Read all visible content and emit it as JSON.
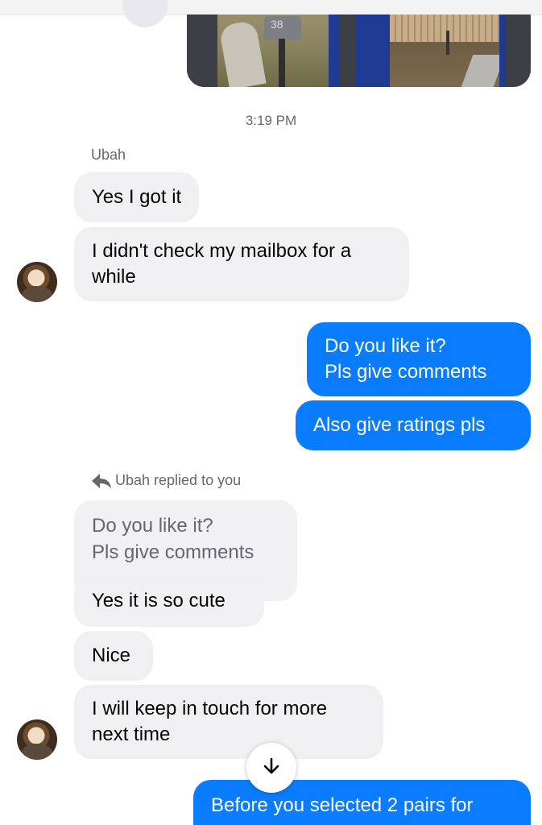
{
  "conversation": {
    "timestamp": "3:19 PM",
    "sender_name": "Ubah",
    "messages": [
      {
        "from": "them",
        "text": "Yes I got it"
      },
      {
        "from": "them",
        "lines": [
          "I didn't check my mailbox for a",
          "while"
        ]
      },
      {
        "from": "me",
        "lines": [
          "Do you like it?",
          "Pls give comments"
        ]
      },
      {
        "from": "me",
        "text": "Also give ratings pls"
      },
      {
        "from": "them",
        "text": "Yes it is so cute"
      },
      {
        "from": "them",
        "text": "Nice"
      },
      {
        "from": "them",
        "lines": [
          "I will keep in touch for more",
          "next time"
        ]
      },
      {
        "from": "me",
        "text": "Before you selected 2 pairs for"
      }
    ],
    "reply_context": {
      "label": "Ubah replied to you",
      "quoted_lines": [
        "Do you like it?",
        "Pls give comments"
      ]
    }
  },
  "media": {
    "photos": [
      {
        "icon": "mailbox-photo",
        "caption_number": "38"
      },
      {
        "icon": "front-yard-photo"
      }
    ]
  },
  "icons": {
    "reply": "reply-arrow-icon",
    "scroll_down": "arrow-down-icon"
  },
  "colors": {
    "outgoing_bubble": "#0a7cff",
    "incoming_bubble": "#f0f0f2",
    "meta_text": "#65676b"
  }
}
